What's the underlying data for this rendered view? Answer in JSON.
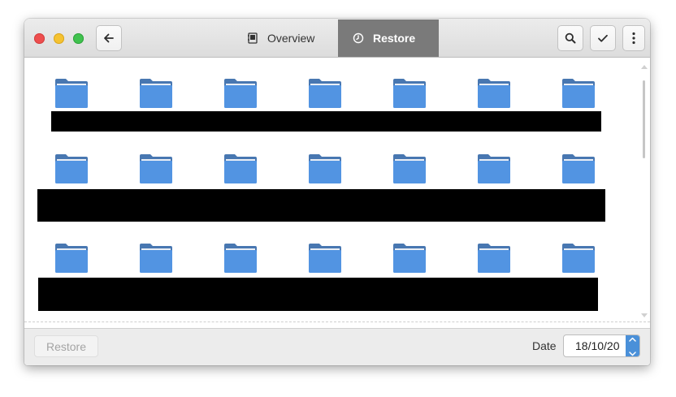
{
  "window": {
    "tabs": [
      {
        "label": "Overview",
        "icon": "backup-book-icon",
        "active": false
      },
      {
        "label": "Restore",
        "icon": "clock-icon",
        "active": true
      }
    ]
  },
  "colors": {
    "folder_body": "#5294e2",
    "folder_tab": "#4877b1",
    "active_tab": "#7a7a7a",
    "spin_button": "#4a90d9"
  },
  "folder_rows": [
    {
      "folders": 7
    },
    {
      "folders": 7
    },
    {
      "folders": 7
    }
  ],
  "footer": {
    "restore_label": "Restore",
    "date_label": "Date",
    "date_value": "18/10/20"
  }
}
